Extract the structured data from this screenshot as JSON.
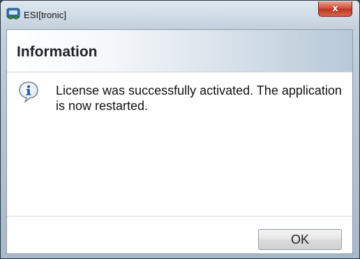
{
  "window": {
    "title": "ESI[tronic]",
    "app_icon": "esi-tronic-app-icon",
    "close_glyph": "x",
    "colors": {
      "close_button": "#c1361f",
      "frame": "#b7c6d4"
    }
  },
  "dialog": {
    "header_title": "Information",
    "icon": "info-icon",
    "message": "License was successfully activated. The application is now restarted.",
    "ok_label": "OK"
  }
}
